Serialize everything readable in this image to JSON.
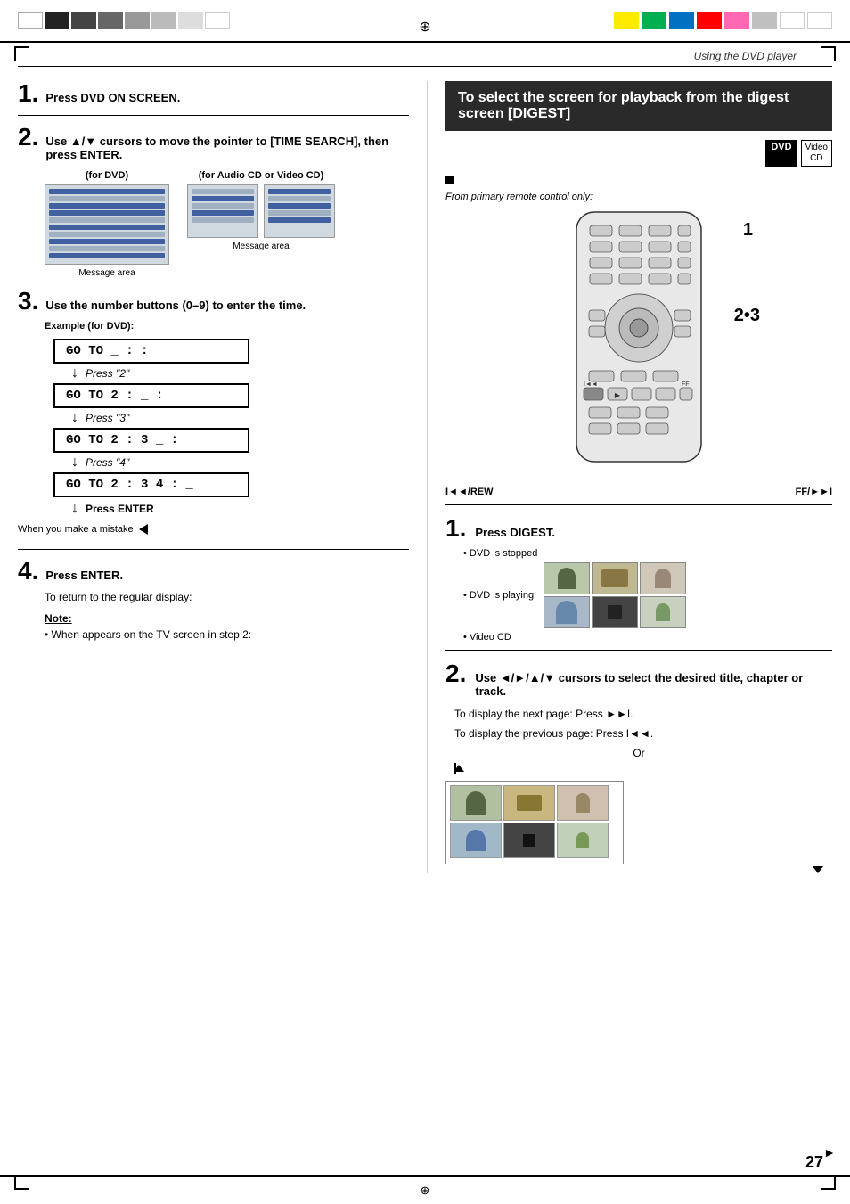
{
  "page": {
    "header_text": "Using the DVD player",
    "page_number": "27",
    "top_center_symbol": "⊕",
    "bottom_center_symbol": "⊕"
  },
  "left": {
    "step1": {
      "num": "1.",
      "text": "Press DVD ON SCREEN."
    },
    "step2": {
      "num": "2.",
      "text": "Use ▲/▼ cursors to move the pointer to [TIME SEARCH], then press ENTER."
    },
    "screen_labels": {
      "dvd": "(for DVD)",
      "audio": "(for Audio CD or Video CD)",
      "msg1": "Message area",
      "msg2": "Message area"
    },
    "step3": {
      "num": "3.",
      "text": "Use the number buttons (0–9) to enter the time.",
      "example": "Example (for DVD):"
    },
    "goto_boxes": [
      {
        "text": "GO TO  _ :    :"
      },
      {
        "press": "Press \"2\""
      },
      {
        "text": "GO TO  2 :  _  :"
      },
      {
        "press": "Press \"3\""
      },
      {
        "text": "GO TO  2 : 3  _ :"
      },
      {
        "press": "Press \"4\""
      },
      {
        "text": "GO TO  2 : 3 4 : _"
      }
    ],
    "press_enter": "Press ENTER",
    "mistake": {
      "label": "When you make a mistake"
    },
    "step4": {
      "num": "4.",
      "text": "Press ENTER."
    },
    "return_text": "To return to the regular display:",
    "note_title": "Note:",
    "note_text": "• When  appears on the TV screen in step 2:"
  },
  "right": {
    "title": "To select the screen for playback from the digest screen [DIGEST]",
    "badges": {
      "dvd": "DVD",
      "vcd_line1": "Video",
      "vcd_line2": "CD"
    },
    "remote_label": "From primary remote control only:",
    "step1": {
      "num": "1.",
      "text": "Press DIGEST.",
      "bullets": [
        "DVD is stopped",
        "DVD is playing",
        "Video CD"
      ]
    },
    "step2": {
      "num": "2.",
      "text": "Use ◄/►/▲/▼ cursors to select the desired title, chapter or track.",
      "next_page": "To display the next page:  Press ►►I.",
      "prev_page": "To display the previous page:  Press I◄◄.",
      "or_text": "Or"
    },
    "rew_label": "I◄◄/REW",
    "ff_label": "FF/►►I",
    "bracket1": "1",
    "bracket23": "2•3"
  }
}
